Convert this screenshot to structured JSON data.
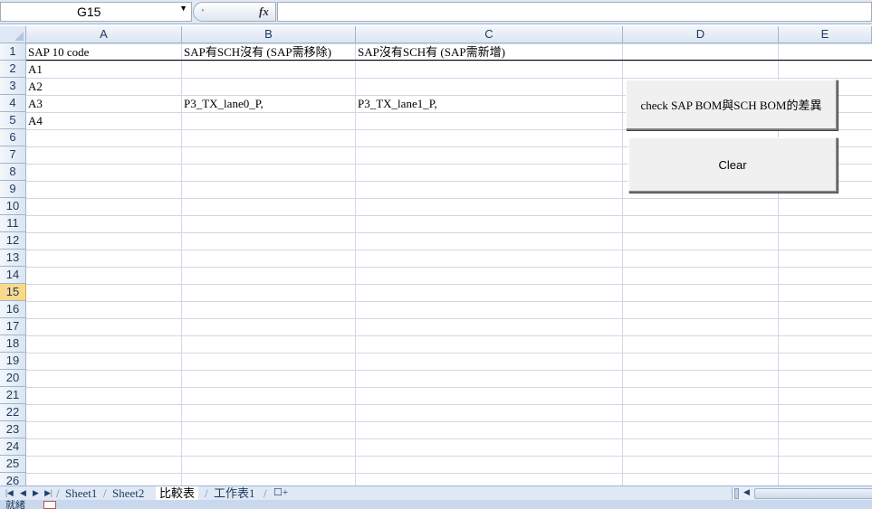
{
  "formula_bar": {
    "name_box": "G15",
    "fx_label": "fx",
    "formula": ""
  },
  "columns": [
    "A",
    "B",
    "C",
    "D",
    "E"
  ],
  "rows": [
    "1",
    "2",
    "3",
    "4",
    "5",
    "6",
    "7",
    "8",
    "9",
    "10",
    "11",
    "12",
    "13",
    "14",
    "15",
    "16",
    "17",
    "18",
    "19",
    "20",
    "21",
    "22",
    "23",
    "24",
    "25",
    "26"
  ],
  "active_row": "15",
  "cells": {
    "A1": "SAP 10 code",
    "B1": "SAP有SCH沒有 (SAP需移除)",
    "C1": "SAP沒有SCH有 (SAP需新增)",
    "A2": "A1",
    "A3": "A2",
    "A4": "A3",
    "B4": "P3_TX_lane0_P,",
    "C4": "P3_TX_lane1_P,",
    "A5": "A4"
  },
  "buttons": {
    "check": "check SAP BOM與SCH BOM的差異",
    "clear": "Clear"
  },
  "sheet_tabs": [
    "Sheet1",
    "Sheet2",
    "比較表",
    "工作表1"
  ],
  "active_tab": "比較表",
  "status_bar": {
    "text": "就緒"
  },
  "icons": [
    "dropdown-arrow-icon",
    "fx-icon",
    "first-sheet-icon",
    "prev-sheet-icon",
    "next-sheet-icon",
    "last-sheet-icon",
    "insert-sheet-icon",
    "macro-record-icon"
  ]
}
